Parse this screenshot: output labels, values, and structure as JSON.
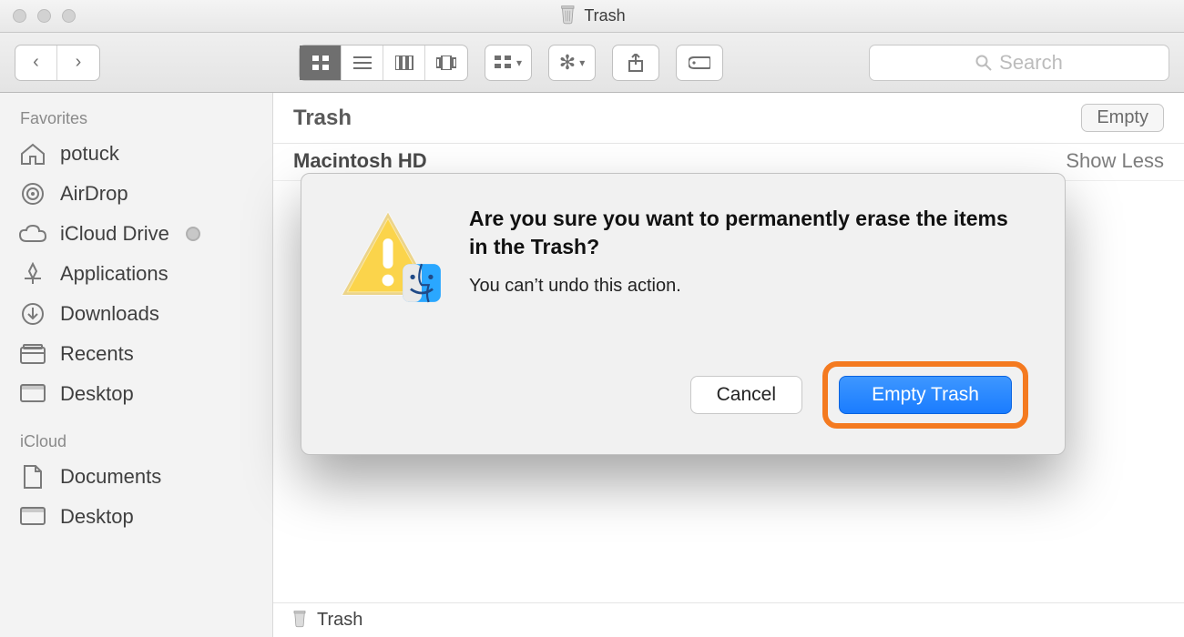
{
  "window": {
    "title": "Trash"
  },
  "toolbar": {
    "search_placeholder": "Search"
  },
  "sidebar": {
    "favorites_heading": "Favorites",
    "icloud_heading": "iCloud",
    "favorites": [
      {
        "label": "potuck",
        "icon": "home"
      },
      {
        "label": "AirDrop",
        "icon": "airdrop"
      },
      {
        "label": "iCloud Drive",
        "icon": "cloud",
        "badge": true
      },
      {
        "label": "Applications",
        "icon": "apps"
      },
      {
        "label": "Downloads",
        "icon": "downloads"
      },
      {
        "label": "Recents",
        "icon": "recents"
      },
      {
        "label": "Desktop",
        "icon": "desktop"
      }
    ],
    "icloud": [
      {
        "label": "Documents",
        "icon": "document"
      },
      {
        "label": "Desktop",
        "icon": "desktop"
      }
    ]
  },
  "header": {
    "title": "Trash",
    "empty_label": "Empty",
    "section": "Macintosh HD",
    "toggle": "Show Less"
  },
  "pathbar": {
    "label": "Trash"
  },
  "dialog": {
    "heading": "Are you sure you want to permanently erase the items in the Trash?",
    "message": "You can’t undo this action.",
    "cancel_label": "Cancel",
    "confirm_label": "Empty Trash"
  }
}
